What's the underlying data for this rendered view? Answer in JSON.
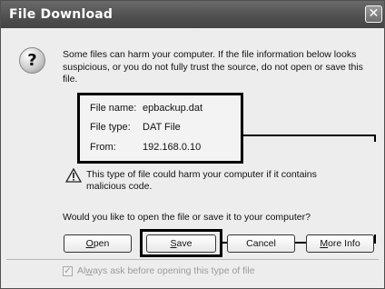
{
  "window": {
    "title": "File Download",
    "close_glyph": "✕"
  },
  "icons": {
    "question": "question-mark-icon",
    "warning": "warning-triangle-icon"
  },
  "message": "Some files can harm your computer. If the file information below looks suspicious, or you do not fully trust the source, do not open or save this file.",
  "file_info": [
    {
      "label": "File name:",
      "value": "epbackup.dat"
    },
    {
      "label": "File type:",
      "value": "DAT File"
    },
    {
      "label": "From:",
      "value": "192.168.0.10"
    }
  ],
  "harm_warning": "This type of file could harm your computer if it contains malicious code.",
  "question": "Would you like to open the file or save it to your computer?",
  "buttons": {
    "open": {
      "accel": "O",
      "rest": "pen"
    },
    "save": {
      "accel": "S",
      "rest": "ave"
    },
    "cancel": "Cancel",
    "more_info": {
      "accel": "M",
      "rest": "ore Info"
    }
  },
  "checkbox": {
    "checked": true,
    "label_pre": "Al",
    "accel": "w",
    "label_post": "ays ask before opening this type of file"
  }
}
